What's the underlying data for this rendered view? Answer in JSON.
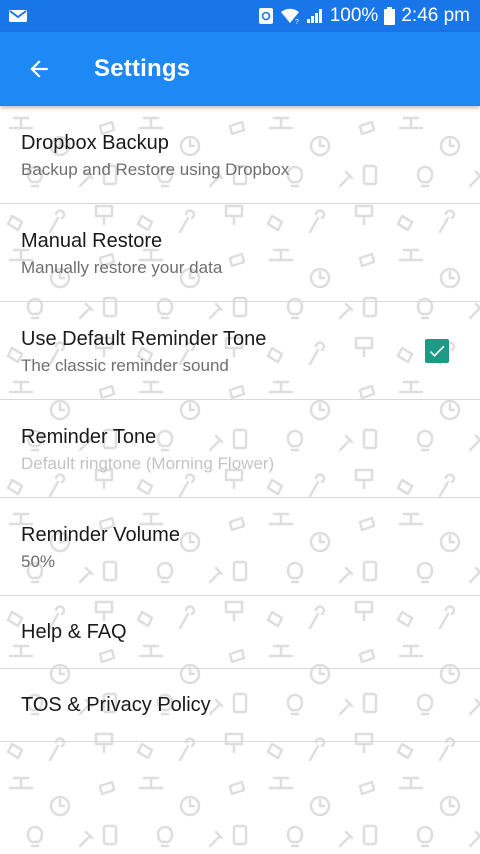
{
  "status_bar": {
    "battery_percent": "100%",
    "time": "2:46 pm",
    "icons": [
      "mail-icon",
      "sync-icon",
      "wifi-icon",
      "signal-icon",
      "battery-icon"
    ]
  },
  "app_bar": {
    "title": "Settings",
    "back_icon": "arrow-left-icon"
  },
  "settings": [
    {
      "title": "Dropbox Backup",
      "subtitle": "Backup and Restore using Dropbox"
    },
    {
      "title": "Manual Restore",
      "subtitle": "Manually restore your data"
    },
    {
      "title": "Use Default Reminder Tone",
      "subtitle": "The classic reminder sound",
      "checked": true
    },
    {
      "title": "Reminder Tone",
      "subtitle": "Default ringtone (Morning Flower)",
      "enabled": false
    },
    {
      "title": "Reminder Volume",
      "subtitle": "50%"
    },
    {
      "title": "Help & FAQ"
    },
    {
      "title": "TOS & Privacy Policy"
    }
  ],
  "colors": {
    "status_bar": "#1976e8",
    "app_bar": "#1e88f5",
    "checkbox": "#1e9a84"
  }
}
